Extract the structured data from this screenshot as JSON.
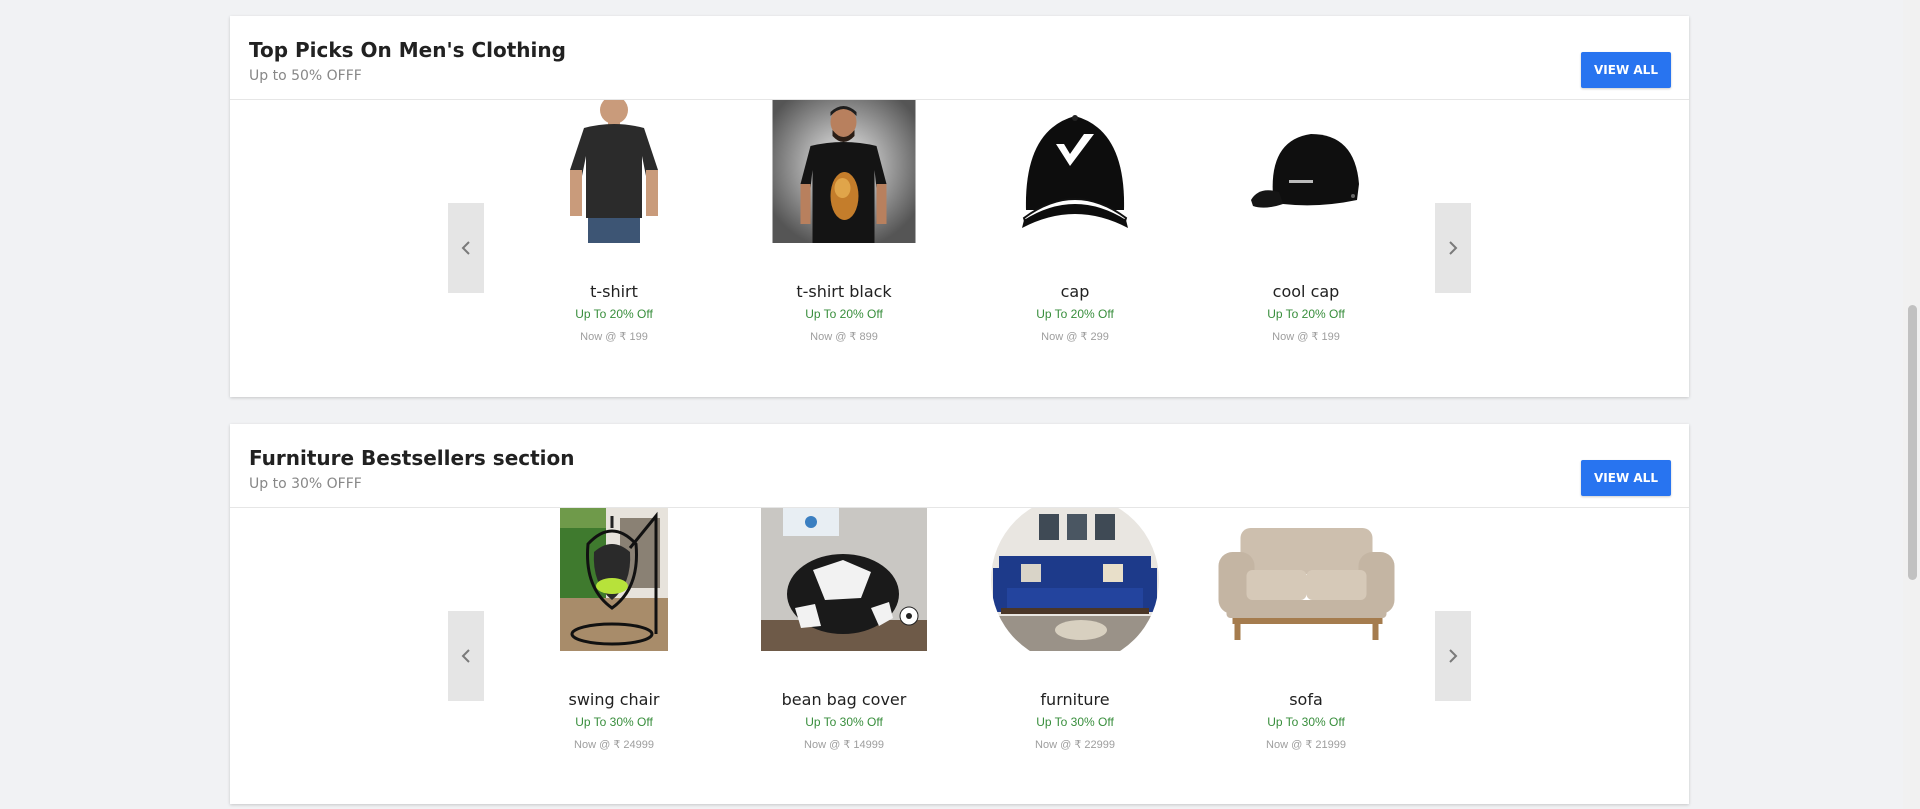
{
  "sections": [
    {
      "title": "Top Picks On Men's Clothing",
      "subtitle": "Up to 50% OFFF",
      "view_all": "VIEW ALL",
      "prev_icon": "chevron-left-icon",
      "next_icon": "chevron-right-icon",
      "items": [
        {
          "name": "t-shirt",
          "offer": "Up To 20% Off",
          "price": "Now @ ₹ 199",
          "image": "dark-tshirt-model"
        },
        {
          "name": "t-shirt black",
          "offer": "Up To 20% Off",
          "price": "Now @ ₹ 899",
          "image": "black-graphic-tshirt-model"
        },
        {
          "name": "cap",
          "offer": "Up To 20% Off",
          "price": "Now @ ₹ 299",
          "image": "black-cap-white-logo"
        },
        {
          "name": "cool cap",
          "offer": "Up To 20% Off",
          "price": "Now @ ₹ 199",
          "image": "black-cap-side"
        }
      ]
    },
    {
      "title": "Furniture Bestsellers section",
      "subtitle": "Up to 30% OFFF",
      "view_all": "VIEW ALL",
      "prev_icon": "chevron-left-icon",
      "next_icon": "chevron-right-icon",
      "items": [
        {
          "name": "swing chair",
          "offer": "Up To 30% Off",
          "price": "Now @ ₹ 24999",
          "image": "hanging-swing-chair"
        },
        {
          "name": "bean bag cover",
          "offer": "Up To 30% Off",
          "price": "Now @ ₹ 14999",
          "image": "football-bean-bag"
        },
        {
          "name": "furniture",
          "offer": "Up To 30% Off",
          "price": "Now @ ₹ 22999",
          "image": "blue-sofa-round"
        },
        {
          "name": "sofa",
          "offer": "Up To 30% Off",
          "price": "Now @ ₹ 21999",
          "image": "beige-sofa"
        }
      ]
    }
  ],
  "colors": {
    "accent": "#2874f0",
    "offer": "#388e3c",
    "price": "#9e9e9e",
    "page_bg": "#f1f2f4"
  }
}
